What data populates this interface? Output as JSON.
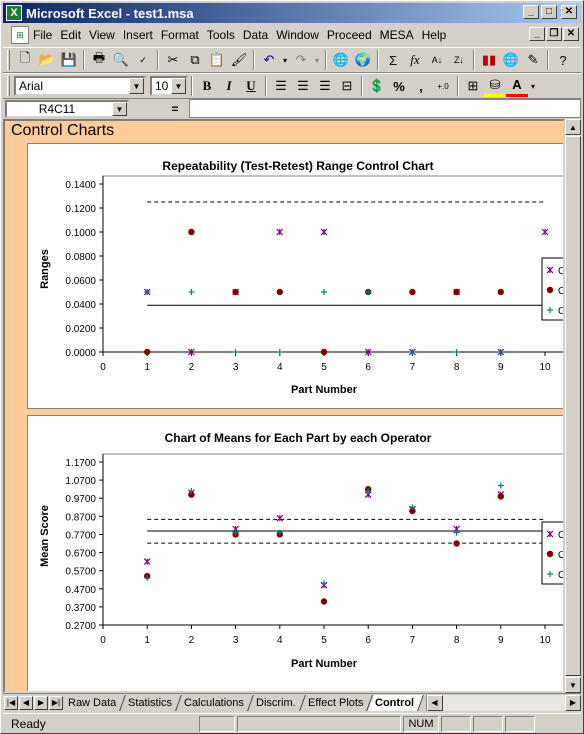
{
  "window": {
    "title": "Microsoft Excel - test1.msa",
    "minimize": "_",
    "maximize": "□",
    "close": "✕"
  },
  "menu": {
    "items": [
      "File",
      "Edit",
      "View",
      "Insert",
      "Format",
      "Tools",
      "Data",
      "Window",
      "Proceed",
      "MESA",
      "Help"
    ]
  },
  "formatting": {
    "font": "Arial",
    "size": "10"
  },
  "formula_bar": {
    "name_box": "R4C11",
    "equals": "="
  },
  "sheet": {
    "title": "Control Charts"
  },
  "tabs": {
    "items": [
      "Raw Data",
      "Statistics",
      "Calculations",
      "Discrim.",
      "Effect Plots",
      "Control"
    ],
    "active": "Control"
  },
  "status": {
    "ready": "Ready",
    "num": "NUM"
  },
  "colors": {
    "series_x": "#800080",
    "series_dot": "#800000",
    "series_plus": "#008080",
    "sheet_bg": "#ffcc99"
  },
  "chart_data": [
    {
      "type": "scatter",
      "title": "Repeatability (Test-Retest) Range Control Chart",
      "xlabel": "Part Number",
      "ylabel": "Ranges",
      "xlim": [
        0,
        10
      ],
      "ylim": [
        0,
        0.14
      ],
      "yticks": [
        "0.0000",
        "0.0200",
        "0.0400",
        "0.0600",
        "0.0800",
        "0.1000",
        "0.1200",
        "0.1400"
      ],
      "xticks": [
        "0",
        "1",
        "2",
        "3",
        "4",
        "5",
        "6",
        "7",
        "8",
        "9",
        "10"
      ],
      "ucl": 0.125,
      "center": 0.039,
      "series": [
        {
          "marker": "x",
          "values": [
            [
              1,
              0.05
            ],
            [
              2,
              0
            ],
            [
              3,
              0.05
            ],
            [
              4,
              0.1
            ],
            [
              5,
              0.1
            ],
            [
              6,
              0
            ],
            [
              7,
              0
            ],
            [
              8,
              0.05
            ],
            [
              9,
              0
            ],
            [
              10,
              0.1
            ]
          ]
        },
        {
          "marker": "dot",
          "values": [
            [
              1,
              0
            ],
            [
              2,
              0.1
            ],
            [
              3,
              0.05
            ],
            [
              4,
              0.05
            ],
            [
              5,
              0
            ],
            [
              6,
              0.05
            ],
            [
              7,
              0.05
            ],
            [
              8,
              0.05
            ],
            [
              9,
              0.05
            ],
            [
              10,
              0.05
            ]
          ]
        },
        {
          "marker": "plus",
          "values": [
            [
              1,
              0.05
            ],
            [
              2,
              0.05
            ],
            [
              3,
              0
            ],
            [
              4,
              0
            ],
            [
              5,
              0.05
            ],
            [
              6,
              0.05
            ],
            [
              7,
              0
            ],
            [
              8,
              0
            ],
            [
              9,
              0
            ],
            [
              10,
              0.05
            ]
          ]
        }
      ],
      "legend": [
        "C",
        "C",
        "C"
      ]
    },
    {
      "type": "scatter",
      "title": "Chart of Means for Each Part by each Operator",
      "xlabel": "Part Number",
      "ylabel": "Mean Score",
      "xlim": [
        0,
        10
      ],
      "ylim": [
        0.27,
        1.17
      ],
      "yticks": [
        "0.2700",
        "0.3700",
        "0.4700",
        "0.5700",
        "0.6700",
        "0.7700",
        "0.8700",
        "0.9700",
        "1.0700",
        "1.1700"
      ],
      "xticks": [
        "0",
        "1",
        "2",
        "3",
        "4",
        "5",
        "6",
        "7",
        "8",
        "9",
        "10"
      ],
      "ucl": 0.853,
      "center": 0.789,
      "lcl": 0.722,
      "series": [
        {
          "marker": "x",
          "values": [
            [
              1,
              0.62
            ],
            [
              2,
              1.0
            ],
            [
              3,
              0.8
            ],
            [
              4,
              0.86
            ],
            [
              5,
              0.49
            ],
            [
              6,
              0.99
            ],
            [
              7,
              0.91
            ],
            [
              8,
              0.8
            ],
            [
              9,
              0.99
            ]
          ]
        },
        {
          "marker": "dot",
          "values": [
            [
              1,
              0.54
            ],
            [
              2,
              0.99
            ],
            [
              3,
              0.77
            ],
            [
              4,
              0.77
            ],
            [
              5,
              0.4
            ],
            [
              6,
              1.02
            ],
            [
              7,
              0.9
            ],
            [
              8,
              0.72
            ],
            [
              9,
              0.98
            ]
          ]
        },
        {
          "marker": "plus",
          "values": [
            [
              1,
              0.53
            ],
            [
              2,
              1.01
            ],
            [
              3,
              0.78
            ],
            [
              4,
              0.78
            ],
            [
              5,
              0.5
            ],
            [
              6,
              1.01
            ],
            [
              7,
              0.92
            ],
            [
              8,
              0.78
            ],
            [
              9,
              1.04
            ]
          ]
        }
      ],
      "legend": [
        "O",
        "O",
        "O"
      ]
    }
  ]
}
